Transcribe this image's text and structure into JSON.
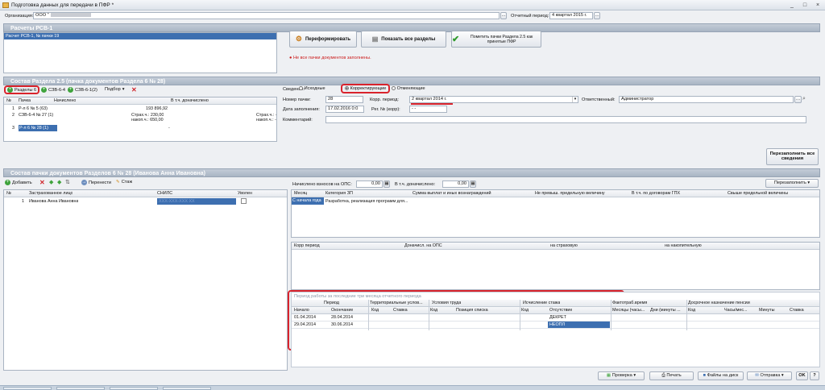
{
  "window": {
    "title": "Подготовка данных для передачи в ПФР *",
    "minimize": "_",
    "maximize": "□",
    "close": "×"
  },
  "top": {
    "org_label": "Организация:",
    "org_value": "ООО \"",
    "period_label": "Отчетный период:",
    "period_value": "4 квартал 2015 г."
  },
  "rsv": {
    "title": "Расчеты РСВ-1",
    "list_item": "Расчет РСВ-1, № пачки 19",
    "btn_reform": "Переформировать",
    "btn_show": "Показать все разделы",
    "btn_mark": "Пометить пачки Раздела 2.5 как принятые ПФР",
    "warning": "Не все пачки документов заполнены."
  },
  "s25": {
    "title": "Состав Раздела 2.5     (пачка документов Раздела 6 № 28)",
    "tb_razdely": "Разделы 6",
    "tb_szv64": "СЗВ-6-4",
    "tb_szv612": "СЗВ-6-1(2)",
    "tb_podbor": "Подбор",
    "cols": [
      "№",
      "Пачка",
      "Начислено",
      "В т.ч. доначислено"
    ],
    "rows": [
      {
        "n": "1",
        "pack": "Р-л 6 № 5 (63)",
        "acc": "193 896,92",
        "extra": ""
      },
      {
        "n": "2",
        "pack": "СЗВ-6-4 № 27 (1)",
        "acc": "Страх.ч.: 230,00",
        "acc2": "накоп.ч.: 650,00",
        "extra": "Страх.ч.: -",
        "extra2": "накоп.ч.: -"
      },
      {
        "n": "3",
        "pack": "Р-л 6 № 28 (1)",
        "acc": "-",
        "extra": "-"
      }
    ]
  },
  "details": {
    "svedenia_label": "Сведения:",
    "opt_ish": "Исходные",
    "opt_korr": "Корректирующие",
    "opt_otm": "Отменяющие",
    "nomer_label": "Номер пачки:",
    "nomer_value": "28",
    "korr_label": "Корр. период:",
    "korr_value": "2 квартал 2014 г.",
    "otv_label": "Ответственный:",
    "otv_value": "Администратор",
    "date_label": "Дата заполнения:",
    "date_value": "17.02.2016  0:0",
    "reg_label": "Рег. № (корр):",
    "reg_value": " -  - ",
    "comment_label": "Комментарий:",
    "refill": "Перезаполнить все сведения"
  },
  "s6": {
    "title": "Состав пачки документов Разделов 6 № 28        (Иванова Анна Ивановна)",
    "tb_add": "Добавить",
    "tb_move": "Перенести",
    "tb_stazh": "Стаж",
    "cols": [
      "№",
      "Застрахованное лицо",
      "СНИЛС",
      "Уволен"
    ],
    "rows": [
      {
        "n": "1",
        "name": "Иванова Анна Ивановна",
        "snils": "XXX-XXX-XXX XX"
      }
    ],
    "nach_label": "Начислено взносов на ОПС:",
    "nach_value": "0,00",
    "dona_label": "В т.ч. доначислено:",
    "dona_value": "0,00",
    "refill": "Перезаполнить"
  },
  "pay": {
    "cols": [
      "Месяц",
      "Категория ЗП",
      "Сумма выплат и иных вознаграждений",
      "Не превыш. предельную величину",
      "В т.ч. по договорам ГПХ",
      "Свыше предельной величины"
    ],
    "row": {
      "month": "С начала года",
      "cat": "Разработка, реализация программ для..."
    }
  },
  "korr": {
    "cols": [
      "Корр период",
      "Доначисл. на ОПС",
      "на страховую",
      "на накопительную"
    ]
  },
  "stazh": {
    "title": "Период работы за последние три месяца отчетного периода",
    "groups": [
      "Период",
      "Территориальные услов...",
      "Условия труда",
      "Исчисление стажа",
      "Фактотраб.время",
      "Досрочное назначение пенсии"
    ],
    "cols": [
      "Начало",
      "Окончание",
      "Код",
      "Ставка",
      "Код",
      "Позиция списка",
      "Код",
      "Отсутствие",
      "Месяцы (часы...",
      "Дни (минуты ...",
      "Код",
      "Часы/мес...",
      "Минуты",
      "Ставка"
    ],
    "rows": [
      {
        "start": "01.04.2014",
        "end": "28.04.2014",
        "abs": "ДЕКРЕТ"
      },
      {
        "start": "29.04.2014",
        "end": "30.06.2014",
        "abs": "НЕОПЛ"
      }
    ]
  },
  "bottom": {
    "check": "Проверка",
    "print": "Печать",
    "files": "Файлы на диск",
    "send": "Отправка",
    "ok": "OK",
    "help": "?"
  }
}
